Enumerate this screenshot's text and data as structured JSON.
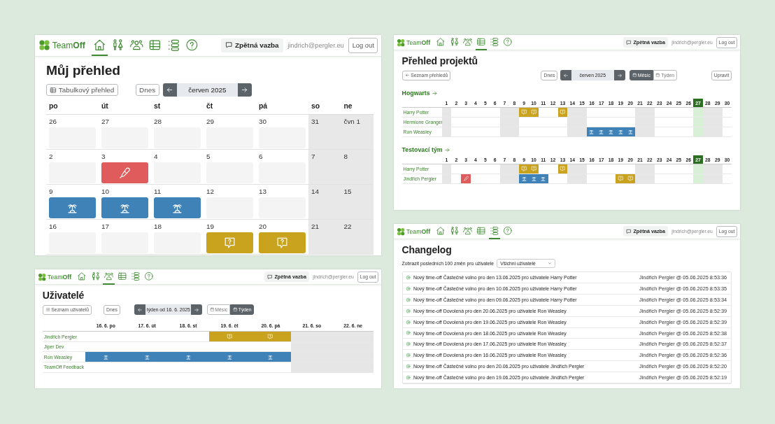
{
  "panels": [
    {
      "kind": "calendar",
      "nav": {
        "logo": "Team**Off**",
        "items": [
          {
            "kind": "home",
            "selected": true
          },
          {
            "kind": "family",
            "selected": false
          },
          {
            "kind": "users",
            "selected": false
          },
          {
            "kind": "table",
            "selected": false
          },
          {
            "kind": "list",
            "selected": false
          },
          {
            "kind": "help",
            "selected": false
          }
        ],
        "feedback": "Zpětná vazba",
        "user": "jindrich@pergler.eu",
        "logout": "Log out"
      },
      "title": "Můj přehled",
      "view_button": "Tabulkový přehled",
      "today_button": "Dnes",
      "period": "červen 2025",
      "weekdays": [
        "po",
        "út",
        "st",
        "čt",
        "pá",
        "so",
        "ne"
      ],
      "weeks": [
        [
          {
            "label": "26",
            "weekend": false,
            "kind": "none"
          },
          {
            "label": "27",
            "weekend": false,
            "kind": "none"
          },
          {
            "label": "28",
            "weekend": false,
            "kind": "none"
          },
          {
            "label": "29",
            "weekend": false,
            "kind": "none"
          },
          {
            "label": "30",
            "weekend": false,
            "kind": "none"
          },
          {
            "label": "31",
            "weekend": true,
            "kind": "none"
          },
          {
            "label": "čvn 1",
            "weekend": true,
            "kind": "none"
          }
        ],
        [
          {
            "label": "2",
            "weekend": false,
            "kind": "none"
          },
          {
            "label": "3",
            "weekend": false,
            "kind": "sick"
          },
          {
            "label": "4",
            "weekend": false,
            "kind": "none"
          },
          {
            "label": "5",
            "weekend": false,
            "kind": "none"
          },
          {
            "label": "6",
            "weekend": false,
            "kind": "none"
          },
          {
            "label": "7",
            "weekend": true,
            "kind": "none"
          },
          {
            "label": "8",
            "weekend": true,
            "kind": "none"
          }
        ],
        [
          {
            "label": "9",
            "weekend": false,
            "kind": "vacation"
          },
          {
            "label": "10",
            "weekend": false,
            "kind": "vacation"
          },
          {
            "label": "11",
            "weekend": false,
            "kind": "vacation"
          },
          {
            "label": "12",
            "weekend": false,
            "kind": "none"
          },
          {
            "label": "13",
            "weekend": false,
            "kind": "none"
          },
          {
            "label": "14",
            "weekend": true,
            "kind": "none"
          },
          {
            "label": "15",
            "weekend": true,
            "kind": "none"
          }
        ],
        [
          {
            "label": "16",
            "weekend": false,
            "kind": "none"
          },
          {
            "label": "17",
            "weekend": false,
            "kind": "none"
          },
          {
            "label": "18",
            "weekend": false,
            "kind": "none"
          },
          {
            "label": "19",
            "weekend": false,
            "kind": "question"
          },
          {
            "label": "20",
            "weekend": false,
            "kind": "question"
          },
          {
            "label": "21",
            "weekend": true,
            "kind": "none"
          },
          {
            "label": "22",
            "weekend": true,
            "kind": "none"
          }
        ]
      ]
    },
    {
      "kind": "projects",
      "nav": {
        "logo": "Team**Off**",
        "items": [
          {
            "kind": "home",
            "selected": false
          },
          {
            "kind": "family",
            "selected": false
          },
          {
            "kind": "users",
            "selected": false
          },
          {
            "kind": "table",
            "selected": true
          },
          {
            "kind": "list",
            "selected": false
          },
          {
            "kind": "help",
            "selected": false
          }
        ],
        "feedback": "Zpětná vazba",
        "user": "jindrich@pergler.eu",
        "logout": "Log out"
      },
      "title": "Přehled projektů",
      "back_button": "Seznam přehledů",
      "today_button": "Dnes",
      "period": "červen 2025",
      "view_toggle": [
        {
          "label": "Měsíc",
          "selected": true
        },
        {
          "label": "Týden",
          "selected": false
        }
      ],
      "edit_button": "Upravit",
      "projects": [
        {
          "name": "Hogwarts",
          "days": [
            {
              "label": "1",
              "weekend": true,
              "today": false
            },
            {
              "label": "2",
              "weekend": false,
              "today": false
            },
            {
              "label": "3",
              "weekend": false,
              "today": false
            },
            {
              "label": "4",
              "weekend": false,
              "today": false
            },
            {
              "label": "5",
              "weekend": false,
              "today": false
            },
            {
              "label": "6",
              "weekend": false,
              "today": false
            },
            {
              "label": "7",
              "weekend": true,
              "today": false
            },
            {
              "label": "8",
              "weekend": true,
              "today": false
            },
            {
              "label": "9",
              "weekend": false,
              "today": false
            },
            {
              "label": "10",
              "weekend": false,
              "today": false
            },
            {
              "label": "11",
              "weekend": false,
              "today": false
            },
            {
              "label": "12",
              "weekend": false,
              "today": false
            },
            {
              "label": "13",
              "weekend": false,
              "today": false
            },
            {
              "label": "14",
              "weekend": true,
              "today": false
            },
            {
              "label": "15",
              "weekend": true,
              "today": false
            },
            {
              "label": "16",
              "weekend": false,
              "today": false
            },
            {
              "label": "17",
              "weekend": false,
              "today": false
            },
            {
              "label": "18",
              "weekend": false,
              "today": false
            },
            {
              "label": "19",
              "weekend": false,
              "today": false
            },
            {
              "label": "20",
              "weekend": false,
              "today": false
            },
            {
              "label": "21",
              "weekend": true,
              "today": false
            },
            {
              "label": "22",
              "weekend": true,
              "today": false
            },
            {
              "label": "23",
              "weekend": false,
              "today": false
            },
            {
              "label": "24",
              "weekend": false,
              "today": false
            },
            {
              "label": "25",
              "weekend": false,
              "today": false
            },
            {
              "label": "26",
              "weekend": false,
              "today": false
            },
            {
              "label": "27",
              "weekend": false,
              "today": true
            },
            {
              "label": "28",
              "weekend": true,
              "today": false
            },
            {
              "label": "29",
              "weekend": true,
              "today": false
            },
            {
              "label": "30",
              "weekend": false,
              "today": false
            }
          ],
          "rows": [
            {
              "name": "Harry Potter",
              "cells": [
                {
                  "kind": "none"
                },
                {
                  "kind": "none"
                },
                {
                  "kind": "none"
                },
                {
                  "kind": "none"
                },
                {
                  "kind": "none"
                },
                {
                  "kind": "none"
                },
                {
                  "kind": "none"
                },
                {
                  "kind": "none"
                },
                {
                  "kind": "question"
                },
                {
                  "kind": "question"
                },
                {
                  "kind": "none"
                },
                {
                  "kind": "none"
                },
                {
                  "kind": "question"
                },
                {
                  "kind": "none"
                },
                {
                  "kind": "none"
                },
                {
                  "kind": "none"
                },
                {
                  "kind": "none"
                },
                {
                  "kind": "none"
                },
                {
                  "kind": "none"
                },
                {
                  "kind": "none"
                },
                {
                  "kind": "none"
                },
                {
                  "kind": "none"
                },
                {
                  "kind": "none"
                },
                {
                  "kind": "none"
                },
                {
                  "kind": "none"
                },
                {
                  "kind": "none"
                },
                {
                  "kind": "none"
                },
                {
                  "kind": "none"
                },
                {
                  "kind": "none"
                },
                {
                  "kind": "none"
                }
              ]
            },
            {
              "name": "Hermione Granger",
              "cells": [
                {
                  "kind": "none"
                },
                {
                  "kind": "none"
                },
                {
                  "kind": "none"
                },
                {
                  "kind": "none"
                },
                {
                  "kind": "none"
                },
                {
                  "kind": "none"
                },
                {
                  "kind": "none"
                },
                {
                  "kind": "none"
                },
                {
                  "kind": "none"
                },
                {
                  "kind": "none"
                },
                {
                  "kind": "none"
                },
                {
                  "kind": "none"
                },
                {
                  "kind": "none"
                },
                {
                  "kind": "none"
                },
                {
                  "kind": "none"
                },
                {
                  "kind": "none"
                },
                {
                  "kind": "none"
                },
                {
                  "kind": "none"
                },
                {
                  "kind": "none"
                },
                {
                  "kind": "none"
                },
                {
                  "kind": "none"
                },
                {
                  "kind": "none"
                },
                {
                  "kind": "none"
                },
                {
                  "kind": "none"
                },
                {
                  "kind": "none"
                },
                {
                  "kind": "none"
                },
                {
                  "kind": "none"
                },
                {
                  "kind": "none"
                },
                {
                  "kind": "none"
                },
                {
                  "kind": "none"
                }
              ]
            },
            {
              "name": "Ron Weasley",
              "cells": [
                {
                  "kind": "none"
                },
                {
                  "kind": "none"
                },
                {
                  "kind": "none"
                },
                {
                  "kind": "none"
                },
                {
                  "kind": "none"
                },
                {
                  "kind": "none"
                },
                {
                  "kind": "none"
                },
                {
                  "kind": "none"
                },
                {
                  "kind": "none"
                },
                {
                  "kind": "none"
                },
                {
                  "kind": "none"
                },
                {
                  "kind": "none"
                },
                {
                  "kind": "none"
                },
                {
                  "kind": "none"
                },
                {
                  "kind": "none"
                },
                {
                  "kind": "vacation"
                },
                {
                  "kind": "vacation"
                },
                {
                  "kind": "vacation"
                },
                {
                  "kind": "vacation"
                },
                {
                  "kind": "vacation"
                },
                {
                  "kind": "none"
                },
                {
                  "kind": "none"
                },
                {
                  "kind": "none"
                },
                {
                  "kind": "none"
                },
                {
                  "kind": "none"
                },
                {
                  "kind": "none"
                },
                {
                  "kind": "none"
                },
                {
                  "kind": "none"
                },
                {
                  "kind": "none"
                },
                {
                  "kind": "none"
                }
              ]
            }
          ]
        },
        {
          "name": "Testovací tým",
          "days": [
            {
              "label": "1",
              "weekend": true,
              "today": false
            },
            {
              "label": "2",
              "weekend": false,
              "today": false
            },
            {
              "label": "3",
              "weekend": false,
              "today": false
            },
            {
              "label": "4",
              "weekend": false,
              "today": false
            },
            {
              "label": "5",
              "weekend": false,
              "today": false
            },
            {
              "label": "6",
              "weekend": false,
              "today": false
            },
            {
              "label": "7",
              "weekend": true,
              "today": false
            },
            {
              "label": "8",
              "weekend": true,
              "today": false
            },
            {
              "label": "9",
              "weekend": false,
              "today": false
            },
            {
              "label": "10",
              "weekend": false,
              "today": false
            },
            {
              "label": "11",
              "weekend": false,
              "today": false
            },
            {
              "label": "12",
              "weekend": false,
              "today": false
            },
            {
              "label": "13",
              "weekend": false,
              "today": false
            },
            {
              "label": "14",
              "weekend": true,
              "today": false
            },
            {
              "label": "15",
              "weekend": true,
              "today": false
            },
            {
              "label": "16",
              "weekend": false,
              "today": false
            },
            {
              "label": "17",
              "weekend": false,
              "today": false
            },
            {
              "label": "18",
              "weekend": false,
              "today": false
            },
            {
              "label": "19",
              "weekend": false,
              "today": false
            },
            {
              "label": "20",
              "weekend": false,
              "today": false
            },
            {
              "label": "21",
              "weekend": true,
              "today": false
            },
            {
              "label": "22",
              "weekend": true,
              "today": false
            },
            {
              "label": "23",
              "weekend": false,
              "today": false
            },
            {
              "label": "24",
              "weekend": false,
              "today": false
            },
            {
              "label": "25",
              "weekend": false,
              "today": false
            },
            {
              "label": "26",
              "weekend": false,
              "today": false
            },
            {
              "label": "27",
              "weekend": false,
              "today": true
            },
            {
              "label": "28",
              "weekend": true,
              "today": false
            },
            {
              "label": "29",
              "weekend": true,
              "today": false
            },
            {
              "label": "30",
              "weekend": false,
              "today": false
            }
          ],
          "rows": [
            {
              "name": "Harry Potter",
              "cells": [
                {
                  "kind": "none"
                },
                {
                  "kind": "none"
                },
                {
                  "kind": "none"
                },
                {
                  "kind": "none"
                },
                {
                  "kind": "none"
                },
                {
                  "kind": "none"
                },
                {
                  "kind": "none"
                },
                {
                  "kind": "none"
                },
                {
                  "kind": "question"
                },
                {
                  "kind": "question"
                },
                {
                  "kind": "none"
                },
                {
                  "kind": "none"
                },
                {
                  "kind": "question"
                },
                {
                  "kind": "none"
                },
                {
                  "kind": "none"
                },
                {
                  "kind": "none"
                },
                {
                  "kind": "none"
                },
                {
                  "kind": "none"
                },
                {
                  "kind": "none"
                },
                {
                  "kind": "none"
                },
                {
                  "kind": "none"
                },
                {
                  "kind": "none"
                },
                {
                  "kind": "none"
                },
                {
                  "kind": "none"
                },
                {
                  "kind": "none"
                },
                {
                  "kind": "none"
                },
                {
                  "kind": "none"
                },
                {
                  "kind": "none"
                },
                {
                  "kind": "none"
                },
                {
                  "kind": "none"
                }
              ]
            },
            {
              "name": "Jindřich Pergler",
              "cells": [
                {
                  "kind": "none"
                },
                {
                  "kind": "none"
                },
                {
                  "kind": "sick"
                },
                {
                  "kind": "none"
                },
                {
                  "kind": "none"
                },
                {
                  "kind": "none"
                },
                {
                  "kind": "none"
                },
                {
                  "kind": "none"
                },
                {
                  "kind": "vacation"
                },
                {
                  "kind": "vacation"
                },
                {
                  "kind": "vacation"
                },
                {
                  "kind": "none"
                },
                {
                  "kind": "none"
                },
                {
                  "kind": "none"
                },
                {
                  "kind": "none"
                },
                {
                  "kind": "none"
                },
                {
                  "kind": "none"
                },
                {
                  "kind": "none"
                },
                {
                  "kind": "question"
                },
                {
                  "kind": "question"
                },
                {
                  "kind": "none"
                },
                {
                  "kind": "none"
                },
                {
                  "kind": "none"
                },
                {
                  "kind": "none"
                },
                {
                  "kind": "none"
                },
                {
                  "kind": "none"
                },
                {
                  "kind": "none"
                },
                {
                  "kind": "none"
                },
                {
                  "kind": "none"
                },
                {
                  "kind": "none"
                }
              ]
            }
          ]
        }
      ]
    },
    {
      "kind": "changelog",
      "nav": {
        "logo": "Team**Off**",
        "items": [
          {
            "kind": "home",
            "selected": false
          },
          {
            "kind": "family",
            "selected": false
          },
          {
            "kind": "users",
            "selected": false
          },
          {
            "kind": "table",
            "selected": false
          },
          {
            "kind": "list",
            "selected": true
          },
          {
            "kind": "help",
            "selected": false
          }
        ],
        "feedback": "Zpětná vazba",
        "user": "jindrich@pergler.eu",
        "logout": "Log out"
      },
      "title": "Changelog",
      "filter_label": "Zobrazit posledních 100 změn pro uživatele",
      "filter_value": "Všichni uživatelé",
      "entries": [
        {
          "text": "Nový time-off Částečné volno pro den 13.06.2025 pro uživatele Harry Potter",
          "meta": "Jindřich Pergler @ 05.06.2025 8:53:36"
        },
        {
          "text": "Nový time-off Částečné volno pro den 10.06.2025 pro uživatele Harry Potter",
          "meta": "Jindřich Pergler @ 05.06.2025 8:53:35"
        },
        {
          "text": "Nový time-off Částečné volno pro den 09.06.2025 pro uživatele Harry Potter",
          "meta": "Jindřich Pergler @ 05.06.2025 8:53:34"
        },
        {
          "text": "Nový time-off Dovolená pro den 20.06.2025 pro uživatele Ron Weasley",
          "meta": "Jindřich Pergler @ 05.06.2025 8:52:39"
        },
        {
          "text": "Nový time-off Dovolená pro den 19.06.2025 pro uživatele Ron Weasley",
          "meta": "Jindřich Pergler @ 05.06.2025 8:52:39"
        },
        {
          "text": "Nový time-off Dovolená pro den 18.06.2025 pro uživatele Ron Weasley",
          "meta": "Jindřich Pergler @ 05.06.2025 8:52:38"
        },
        {
          "text": "Nový time-off Dovolená pro den 17.06.2025 pro uživatele Ron Weasley",
          "meta": "Jindřich Pergler @ 05.06.2025 8:52:37"
        },
        {
          "text": "Nový time-off Dovolená pro den 16.06.2025 pro uživatele Ron Weasley",
          "meta": "Jindřich Pergler @ 05.06.2025 8:52:36"
        },
        {
          "text": "Nový time-off Částečné volno pro den 20.06.2025 pro uživatele Jindřich Pergler",
          "meta": "Jindřich Pergler @ 05.06.2025 8:52:20"
        },
        {
          "text": "Nový time-off Částečné volno pro den 19.06.2025 pro uživatele Jindřich Pergler",
          "meta": "Jindřich Pergler @ 05.06.2025 8:52:19"
        }
      ]
    },
    {
      "kind": "users",
      "nav": {
        "logo": "Team**Off**",
        "items": [
          {
            "kind": "home",
            "selected": false
          },
          {
            "kind": "family",
            "selected": false
          },
          {
            "kind": "users",
            "selected": true
          },
          {
            "kind": "table",
            "selected": false
          },
          {
            "kind": "list",
            "selected": false
          },
          {
            "kind": "help",
            "selected": false
          }
        ],
        "feedback": "Zpětná vazba",
        "user": "jindrich@pergler.eu",
        "logout": "Log out"
      },
      "title": "Uživatelé",
      "list_button": "Seznam uživatelů",
      "today_button": "Dnes",
      "period": "týden od 16. 6. 2025",
      "view_toggle": [
        {
          "label": "Měsíc",
          "selected": false
        },
        {
          "label": "Týden",
          "selected": true
        }
      ],
      "columns": [
        {
          "label": "16. 6. po",
          "weekend": false
        },
        {
          "label": "17. 6. út",
          "weekend": false
        },
        {
          "label": "18. 6. st",
          "weekend": false
        },
        {
          "label": "19. 6. čt",
          "weekend": false
        },
        {
          "label": "20. 6. pá",
          "weekend": false
        },
        {
          "label": "21. 6. so",
          "weekend": true
        },
        {
          "label": "22. 6. ne",
          "weekend": true
        }
      ],
      "rows": [
        {
          "name": "Jindřich Pergler",
          "cells": [
            {
              "kind": "none"
            },
            {
              "kind": "none"
            },
            {
              "kind": "none"
            },
            {
              "kind": "question"
            },
            {
              "kind": "question"
            },
            {
              "kind": "none"
            },
            {
              "kind": "none"
            }
          ]
        },
        {
          "name": "Jiper Dev",
          "cells": [
            {
              "kind": "none"
            },
            {
              "kind": "none"
            },
            {
              "kind": "none"
            },
            {
              "kind": "none"
            },
            {
              "kind": "none"
            },
            {
              "kind": "none"
            },
            {
              "kind": "none"
            }
          ]
        },
        {
          "name": "Ron Weasley",
          "cells": [
            {
              "kind": "vacation"
            },
            {
              "kind": "vacation"
            },
            {
              "kind": "vacation"
            },
            {
              "kind": "vacation"
            },
            {
              "kind": "vacation"
            },
            {
              "kind": "none"
            },
            {
              "kind": "none"
            }
          ]
        },
        {
          "name": "TeamOff Feedback",
          "cells": [
            {
              "kind": "none"
            },
            {
              "kind": "none"
            },
            {
              "kind": "none"
            },
            {
              "kind": "none"
            },
            {
              "kind": "none"
            },
            {
              "kind": "none"
            },
            {
              "kind": "none"
            }
          ]
        }
      ]
    }
  ]
}
